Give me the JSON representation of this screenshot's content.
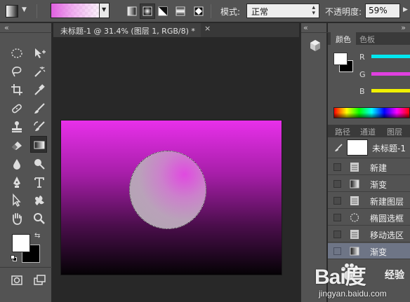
{
  "options_bar": {
    "mode_label": "模式:",
    "mode_value": "正常",
    "opacity_label": "不透明度:",
    "opacity_value": "59%",
    "gradient_types": [
      "linear-gradient-icon",
      "radial-gradient-icon",
      "angle-gradient-icon",
      "reflected-gradient-icon",
      "diamond-gradient-icon"
    ],
    "active_gradient_type": "radial-gradient-icon"
  },
  "document": {
    "tab_title": "未标题-1 @ 31.4% (图层 1, RGB/8) *",
    "close_glyph": "×",
    "canvas_gradient_top": "#e830ea",
    "canvas_gradient_bottom": "#050205"
  },
  "toolbox": {
    "collapse_glyph": "«",
    "tools": [
      "marquee-tool-icon",
      "move-tool-icon",
      "lasso-tool-icon",
      "magic-wand-tool-icon",
      "crop-tool-icon",
      "eyedropper-tool-icon",
      "healing-brush-tool-icon",
      "brush-tool-icon",
      "clone-stamp-tool-icon",
      "history-brush-tool-icon",
      "eraser-tool-icon",
      "gradient-tool-icon",
      "blur-tool-icon",
      "dodge-tool-icon",
      "pen-tool-icon",
      "type-tool-icon",
      "path-selection-tool-icon",
      "custom-shape-tool-icon",
      "hand-tool-icon",
      "zoom-tool-icon"
    ],
    "active_tool": "gradient-tool-icon",
    "foreground_color": "#ffffff",
    "background_color": "#000000"
  },
  "color_panel": {
    "tabs": [
      "颜色",
      "色板"
    ],
    "active_tab": "颜色",
    "sliders": [
      {
        "label": "R",
        "color": "#00e8f0"
      },
      {
        "label": "G",
        "color": "#e040e0"
      },
      {
        "label": "B",
        "color": "#f0f000"
      }
    ]
  },
  "layers_panel": {
    "tabs": [
      "路径",
      "通道",
      "图层"
    ],
    "active_tab": "图层",
    "snapshot_label": "未标题-1",
    "history": [
      {
        "name": "新建",
        "icon": "document-icon",
        "selected": false
      },
      {
        "name": "渐变",
        "icon": "gradient-icon",
        "selected": false
      },
      {
        "name": "新建图层",
        "icon": "document-icon",
        "selected": false
      },
      {
        "name": "椭圆选框",
        "icon": "ellipse-marquee-icon",
        "selected": false
      },
      {
        "name": "移动选区",
        "icon": "document-icon",
        "selected": false
      },
      {
        "name": "渐变",
        "icon": "gradient-icon",
        "selected": true
      }
    ]
  },
  "watermark": {
    "logo": "Bai度",
    "sub": "经验",
    "url": "jingyan.baidu.com"
  }
}
